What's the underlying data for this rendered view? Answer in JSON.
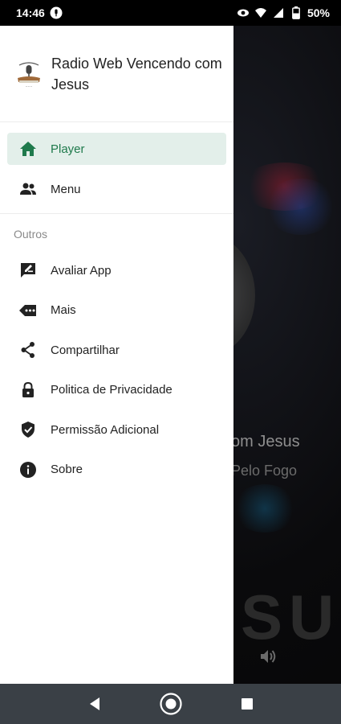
{
  "status_bar": {
    "time": "14:46",
    "battery": "50%",
    "icons": [
      "mic-icon",
      "eye-icon",
      "wifi-icon",
      "signal-icon",
      "battery-icon"
    ]
  },
  "drawer": {
    "app_title": "Radio Web Vencendo com Jesus",
    "primary_items": [
      {
        "label": "Player",
        "icon": "home-icon",
        "active": true
      },
      {
        "label": "Menu",
        "icon": "people-icon",
        "active": false
      }
    ],
    "section_label": "Outros",
    "other_items": [
      {
        "label": "Avaliar App",
        "icon": "rate-review-icon"
      },
      {
        "label": "Mais",
        "icon": "more-tag-icon"
      },
      {
        "label": "Compartilhar",
        "icon": "share-icon"
      },
      {
        "label": "Politica de Privacidade",
        "icon": "lock-icon"
      },
      {
        "label": "Permissão Adicional",
        "icon": "shield-check-icon"
      },
      {
        "label": "Sobre",
        "icon": "info-icon"
      }
    ]
  },
  "background_player": {
    "title_fragment": "om Jesus",
    "subtitle_fragment": "Pelo Fogo",
    "big_text": "SUS"
  },
  "colors": {
    "accent": "#1f7a4c",
    "active_bg": "#e3efea",
    "nav_bar": "#3a4046"
  }
}
